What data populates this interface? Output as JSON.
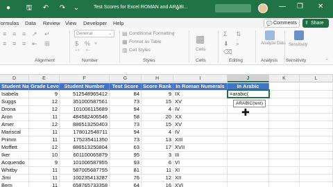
{
  "window": {
    "title": "Test Scores for Excel ROMAN and ARABI...",
    "comments_label": "Comments",
    "share_label": "Share"
  },
  "menu": [
    "Formulas",
    "Data",
    "Review",
    "View",
    "Developer",
    "Help"
  ],
  "ribbon": {
    "font_name": "General",
    "cond_format": "Conditional Formatting",
    "format_table": "Format as Table",
    "cell_styles": "Cell Styles",
    "cells_label": "Cells",
    "analyze_data": "Analyze Data",
    "sensitivity": "Sensitivity",
    "groups": [
      "Alignment",
      "Number",
      "Styles",
      "Cells",
      "Editing",
      "Analysis",
      "Sensitivity"
    ]
  },
  "columns": [
    "D",
    "E",
    "F",
    "G",
    "H",
    "I",
    "J",
    "K",
    "L"
  ],
  "selected_column": "J",
  "table": {
    "headers": [
      "Student Name",
      "Grade Level",
      "Student Number",
      "Test Score",
      "Score Rank",
      "In Roman Numerals",
      "In Arabic"
    ],
    "rows": [
      [
        "Isabela",
        "9",
        "512548965412",
        "84",
        "9",
        "IX"
      ],
      [
        "Suggs",
        "12",
        "351000587561",
        "73",
        "15",
        "XV"
      ],
      [
        "Drona",
        "12",
        "101006115689",
        "94",
        "4",
        "IV"
      ],
      [
        "Aron",
        "11",
        "484582406546",
        "58",
        "20",
        "XX"
      ],
      [
        "Amer",
        "12",
        "886513250403",
        "73",
        "15",
        "XV"
      ],
      [
        "Mariscal",
        "11",
        "178012548711",
        "94",
        "4",
        "IV"
      ],
      [
        "Primm",
        "11",
        "175235411350",
        "73",
        "13",
        "XIII"
      ],
      [
        "Moffett",
        "12",
        "886513250804",
        "63",
        "17",
        "XVII"
      ],
      [
        "Iker",
        "10",
        "601100065879",
        "95",
        "3",
        "III"
      ],
      [
        "Acquendo",
        "9",
        "101006587955",
        "93",
        "6",
        "VI"
      ],
      [
        "Whitby",
        "11",
        "587005687755",
        "81",
        "11",
        "XI"
      ],
      [
        "Jimi",
        "11",
        "100235413287",
        "76",
        "12",
        "XII"
      ],
      [
        "Bern",
        "11",
        "658765733358",
        "64",
        "16",
        "XVI"
      ]
    ]
  },
  "editing_cell": {
    "formula": "=arabic(",
    "tooltip": "ARABIC(text)"
  }
}
